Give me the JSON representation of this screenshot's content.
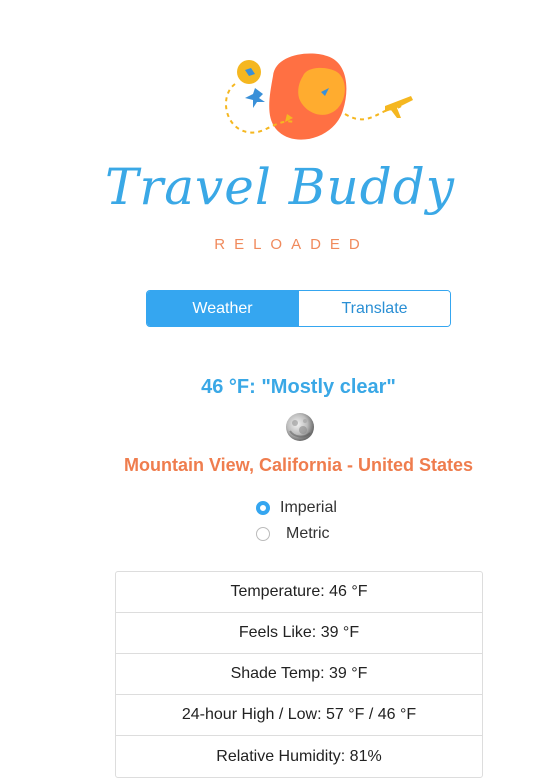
{
  "brand": {
    "title": "Travel Buddy",
    "subtitle": "RELOADED"
  },
  "tabs": [
    {
      "label": "Weather",
      "active": true
    },
    {
      "label": "Translate",
      "active": false
    }
  ],
  "weather": {
    "condition": "46 °F: \"Mostly clear\"",
    "icon": "moon-icon",
    "location": "Mountain View, California - United States"
  },
  "units": [
    {
      "label": "Imperial",
      "checked": true
    },
    {
      "label": "Metric",
      "checked": false
    }
  ],
  "stats": [
    "Temperature: 46 °F",
    "Feels Like: 39 °F",
    "Shade Temp: 39 °F",
    "24-hour High / Low: 57 °F / 46 °F",
    "Relative Humidity: 81%"
  ],
  "colors": {
    "accent": "#35a6f0",
    "orange": "#ef7d4e",
    "yellow": "#f5b720"
  }
}
